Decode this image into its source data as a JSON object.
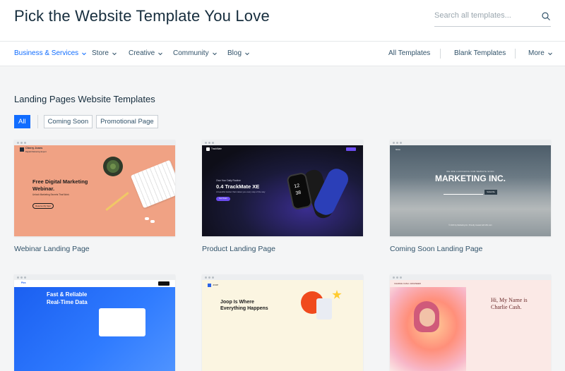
{
  "header": {
    "title": "Pick the Website Template You Love",
    "search_placeholder": "Search all templates..."
  },
  "nav": {
    "categories": [
      {
        "label": "Business & Services",
        "active": true
      },
      {
        "label": "Store"
      },
      {
        "label": "Creative"
      },
      {
        "label": "Community"
      },
      {
        "label": "Blog"
      }
    ],
    "right": [
      "All Templates",
      "Blank Templates",
      "More"
    ]
  },
  "section": {
    "title": "Landing Pages Website Templates",
    "filters": [
      "All",
      "Coming Soon",
      "Promotional Page"
    ]
  },
  "templates": [
    {
      "label": "Webinar Landing Page",
      "preview": {
        "brand": "Cherry Jones",
        "brand_sub": "Digital Marketing Expert",
        "headline_1": "Free Digital Marketing",
        "headline_2": "Webinar.",
        "sub": "Unlock Marketing Secrets That Work",
        "button": "Reserve My Spot"
      }
    },
    {
      "label": "Product Landing Page",
      "preview": {
        "brand": "TrackMate",
        "pre": "Own Your Daily Routine",
        "headline": "0.4 TrackMate XE",
        "sub": "A beautiful tracker that makes you every step of the way",
        "button": "Get Yours",
        "watch_time": "12",
        "watch_time_2": "38"
      }
    },
    {
      "label": "Coming Soon Landing Page",
      "preview": {
        "brand": "Glow",
        "pre": "WE ARE LAUNCHING OUR WEBSITE SOON",
        "headline": "MARKETING INC.",
        "button": "Subscribe",
        "footer": "© 2023 by Marketing Inc. Proudly created with Wix.com"
      }
    },
    {
      "label": "",
      "preview": {
        "brand": "Plex",
        "headline_1": "Fast & Reliable",
        "headline_2": "Real-Time Data"
      }
    },
    {
      "label": "",
      "preview": {
        "brand": "JOOP",
        "headline_1": "Joop Is Where",
        "headline_2": "Everything Happens"
      }
    },
    {
      "label": "",
      "preview": {
        "brand": "CHARLIE CASH • ENGINEER",
        "headline_1": "Hi, My Name is",
        "headline_2": "Charlie Cash."
      }
    }
  ],
  "colors": {
    "accent": "#116dff",
    "title": "#162d3d",
    "text": "#32536a",
    "page_bg": "#f4f5f6"
  }
}
